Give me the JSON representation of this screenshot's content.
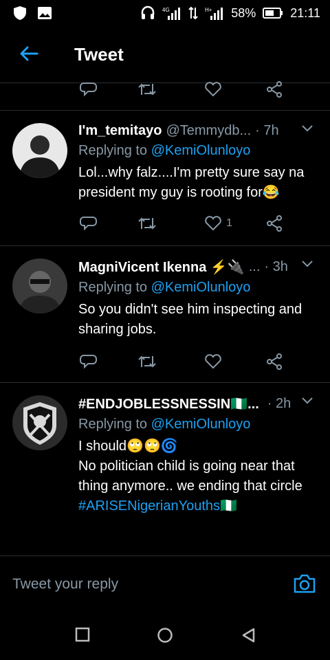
{
  "status_bar": {
    "battery_percent": "58%",
    "time": "21:11",
    "left_icons": [
      "shield-icon",
      "image-icon"
    ],
    "right_icons": [
      "headphones-icon",
      "signal-icon",
      "data-icon",
      "signal-icon",
      "battery-icon"
    ]
  },
  "header": {
    "title": "Tweet"
  },
  "tweets": [
    {
      "name": "I'm_temitayo",
      "handle": "@Temmydb...",
      "time": "· 7h",
      "reply_prefix": "Replying to ",
      "reply_mention": "@KemiOlunloyo",
      "body": "Lol...why falz....I'm pretty sure say na president my guy is rooting for😂",
      "like_count": "1"
    },
    {
      "name": "MagniVicent Ikenna ⚡🔌",
      "handle": "...",
      "time": "· 3h",
      "reply_prefix": "Replying to ",
      "reply_mention": "@KemiOlunloyo",
      "body": "So you didn't see him inspecting and sharing jobs.",
      "like_count": ""
    },
    {
      "name": "#ENDJOBLESSNESSIN🇳🇬...",
      "handle": "",
      "time": "· 2h",
      "reply_prefix": "Replying to ",
      "reply_mention": "@KemiOlunloyo",
      "body_line1": "I should🙄🙄🌀",
      "body_line2": "No politician child is going near that thing anymore.. we ending that circle",
      "hashtag": "#ARISENigerianYouths🇳🇬",
      "like_count": ""
    }
  ],
  "composer": {
    "placeholder": "Tweet your reply"
  },
  "colors": {
    "accent": "#1da1f2",
    "muted": "#8899a6",
    "background": "#000000"
  }
}
